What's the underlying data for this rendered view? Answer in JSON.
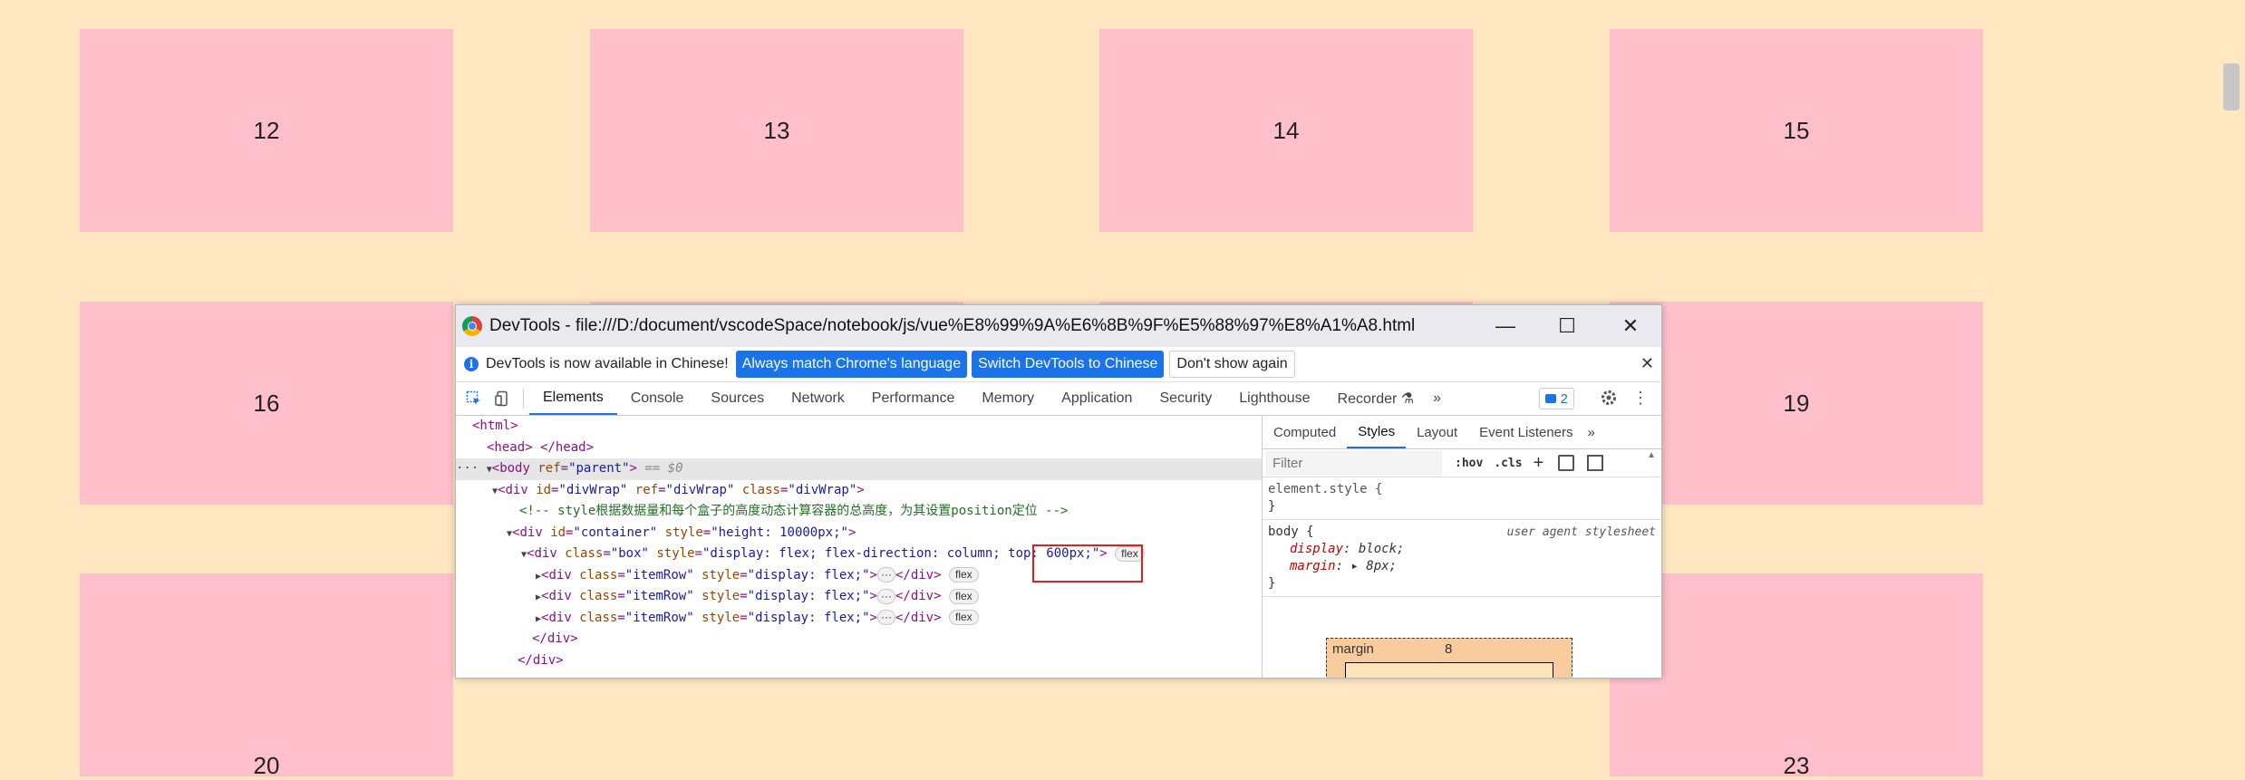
{
  "boxes": [
    "12",
    "13",
    "14",
    "15",
    "16",
    "19",
    "20",
    "23"
  ],
  "devtools": {
    "title": "DevTools - file:///D:/document/vscodeSpace/notebook/js/vue%E8%99%9A%E6%8B%9F%E5%88%97%E8%A1%A8.html",
    "window_buttons": {
      "minimize": "—",
      "maximize": "☐",
      "close": "✕"
    },
    "infobar": {
      "icon": "i",
      "message": "DevTools is now available in Chinese!",
      "btn1": "Always match Chrome's language",
      "btn2": "Switch DevTools to Chinese",
      "btn3": "Don't show again",
      "close": "✕"
    },
    "tabs": [
      "Elements",
      "Console",
      "Sources",
      "Network",
      "Performance",
      "Memory",
      "Application",
      "Security",
      "Lighthouse",
      "Recorder ⚗"
    ],
    "more": "»",
    "issues_count": "2",
    "elements": {
      "l1": "<html>",
      "l2": "<head> </head>",
      "l3_tag": "<body ",
      "l3_attr": "ref",
      "l3_val": "\"parent\"",
      "l3_tail": "> == $0",
      "l3_dots": "···",
      "l4_tag": "<div ",
      "l4_a1": "id",
      "l4_v1": "\"divWrap\"",
      "l4_a2": "ref",
      "l4_v2": "\"divWrap\"",
      "l4_a3": "class",
      "l4_v3": "\"divWrap\"",
      "l5": "<!-- style根据数据量和每个盒子的高度动态计算容器的总高度，为其设置position定位 -->",
      "l6_tag": "<div ",
      "l6_a1": "id",
      "l6_v1": "\"container\"",
      "l6_a2": "style",
      "l6_v2": "\"height: 10000px;\"",
      "l7_tag": "<div ",
      "l7_a1": "class",
      "l7_v1": "\"box\"",
      "l7_a2": "style",
      "l7_v2a": "\"display: flex; flex-direction: column;",
      "l7_v2b": "top: 600px;\"",
      "row_tag": "<div ",
      "row_a1": "class",
      "row_v1": "\"itemRow\"",
      "row_a2": "style",
      "row_v2": "\"display: flex;\"",
      "row_tail": "</div>",
      "flex_pill": "flex",
      "close_div": "</div>",
      "ellipsis": "···"
    },
    "styles": {
      "subtabs": [
        "Computed",
        "Styles",
        "Layout",
        "Event Listeners"
      ],
      "filter_placeholder": "Filter",
      "hov": ":hov",
      "cls": ".cls",
      "plus": "+",
      "element_style": "element.style {",
      "brace_close": "}",
      "body_selector": "body {",
      "ua": "user agent stylesheet",
      "display_prop": "display",
      "display_val": "block;",
      "margin_prop": "margin",
      "margin_val": "8px;",
      "boxmodel_label": "margin",
      "boxmodel_value": "8"
    }
  }
}
